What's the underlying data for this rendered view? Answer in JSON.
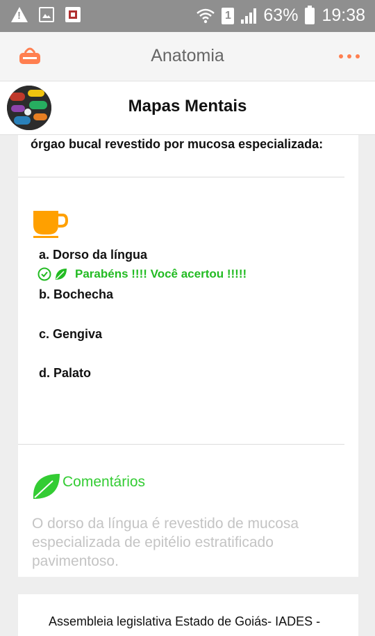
{
  "status_bar": {
    "battery": "63%",
    "time": "19:38",
    "sim_slot": "1"
  },
  "app_bar": {
    "title": "Anatomia"
  },
  "header": {
    "title": "Mapas Mentais"
  },
  "question": {
    "text_visible": "órgao bucal revestido por mucosa especializada:",
    "options": [
      {
        "label": "a. Dorso da língua"
      },
      {
        "label": "b. Bochecha"
      },
      {
        "label": "c. Gengiva"
      },
      {
        "label": "d. Palato"
      }
    ],
    "feedback": "Parabéns !!!!  Você acertou !!!!!"
  },
  "comments": {
    "title": "Comentários",
    "text": "O dorso da língua é revestido de mucosa especializada de epitélio estratificado pavimentoso."
  },
  "reference": {
    "text": "Assembleia legislativa Estado de Goiás- IADES -"
  },
  "colors": {
    "accent": "#ff7f50",
    "success": "#22bb22",
    "cup": "#ffa000",
    "leaf": "#33cc33"
  },
  "icons": [
    "warning-icon",
    "image-icon",
    "app-notification-icon",
    "wifi-icon",
    "signal-icon",
    "battery-icon",
    "shop-basket-icon",
    "more-dots-icon",
    "cup-icon",
    "check-circle-icon",
    "leaf-icon"
  ]
}
